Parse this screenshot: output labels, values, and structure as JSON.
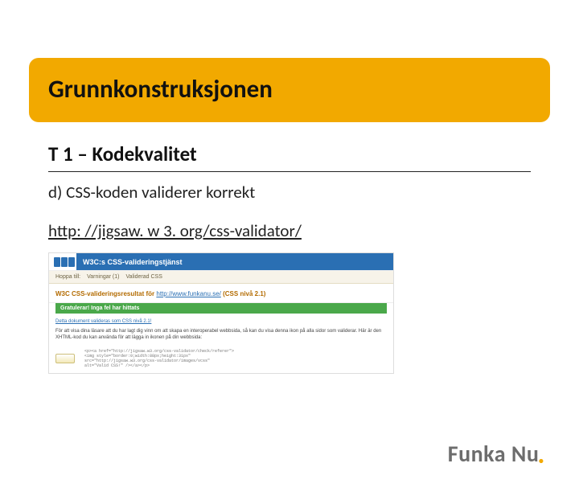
{
  "title": "Grunnkonstruksjonen",
  "subtitle": "T 1 – Kodekvalitet",
  "item": "d)  CSS-koden validerer korrekt",
  "link_text": "http: //jigsaw. w 3. org/css-validator/",
  "link_href": "http://jigsaw.w3.org/css-validator/",
  "validator": {
    "banner": "W3C:s CSS-valideringstjänst",
    "tab1": "Hoppa till:",
    "tab2": "Varningar (1)",
    "tab3": "Validerad CSS",
    "result_label": "W3C CSS-valideringsresultat för",
    "result_url": "http://www.funkanu.se/",
    "result_level": "(CSS nivå 2.1)",
    "success": "Gratulerar! Inga fel har hittats",
    "body_line1": "Detta dokument valideras som CSS nivå 2.1!",
    "body_line2": "För att visa dina läsare att du har lagt dig vinn om att skapa en interoperabel webbsida, så kan du visa denna ikon på alla sidor som validerar. Här är den XHTML-kod du kan använda för att lägga in ikonen på din webbsida:",
    "code1": "<p><a href=\"http://jigsaw.w3.org/css-validator/check/referer\">",
    "code2": "<img style=\"border:0;width:88px;height:31px\"",
    "code3": " src=\"http://jigsaw.w3.org/css-validator/images/vcss\"",
    "code4": " alt=\"Valid CSS!\" /></a></p>"
  },
  "brand": "Funka Nu"
}
